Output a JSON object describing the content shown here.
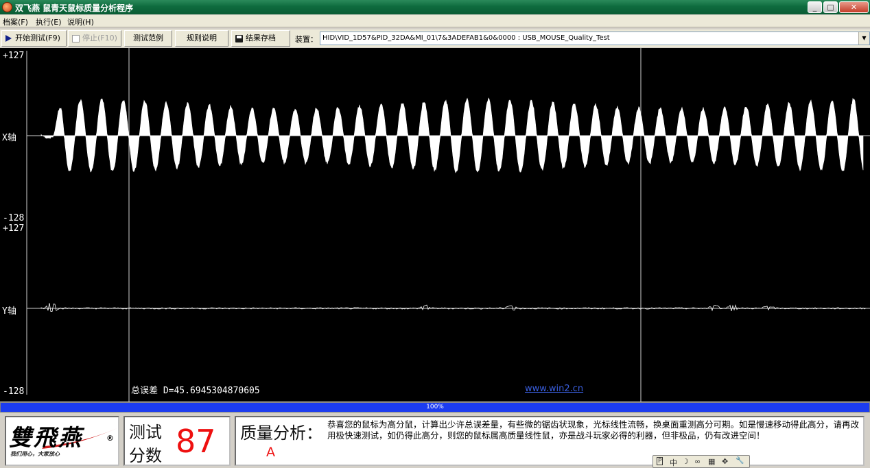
{
  "window": {
    "title": "双飞燕 鼠青天鼠标质量分析程序",
    "controls": {
      "minimize": "_",
      "maximize": "□",
      "close": "✕"
    }
  },
  "menu": [
    "档案(F)",
    "执行(E)",
    "说明(H)"
  ],
  "toolbar": {
    "start": "开始测试(F9)",
    "stop": "停止(F10)",
    "example": "测试范例",
    "rules": "规则说明",
    "save": "结果存档",
    "device_label": "装置：",
    "device_value": "HID\\VID_1D57&PID_32DA&MI_01\\7&3ADEFAB1&0&0000 : USB_MOUSE_Quality_Test"
  },
  "scope": {
    "x_top": "+127",
    "x_axis": "X轴",
    "x_bottom": "-128",
    "y_top": "+127",
    "y_axis": "Y轴",
    "y_bottom": "-128",
    "error_text": "总误差 D=45.6945304870605",
    "website": "www.win2.cn"
  },
  "progress": {
    "text": "100%",
    "value": 1.0
  },
  "logo": {
    "name": "雙飛燕",
    "reg": "®",
    "slogan": "我们用心，大家放心"
  },
  "score": {
    "line1": "测试",
    "line2": "分数",
    "value": "87"
  },
  "quality": {
    "title": "质量分析：",
    "grade": "A",
    "description": "恭喜您的鼠标为高分鼠，计算出少许总误差量，有些微的锯齿状现象，光标线性流畅，换桌面重测高分可期。如是慢速移动得此高分，请再改用极快速测试，如仍得此高分，则您的鼠标属高质量线性鼠，亦是战斗玩家必得的利器，但非极品，仍有改进空间！"
  },
  "ime": [
    "P",
    "中",
    "☽",
    "∞",
    "▦",
    "✥",
    "🔧"
  ]
}
